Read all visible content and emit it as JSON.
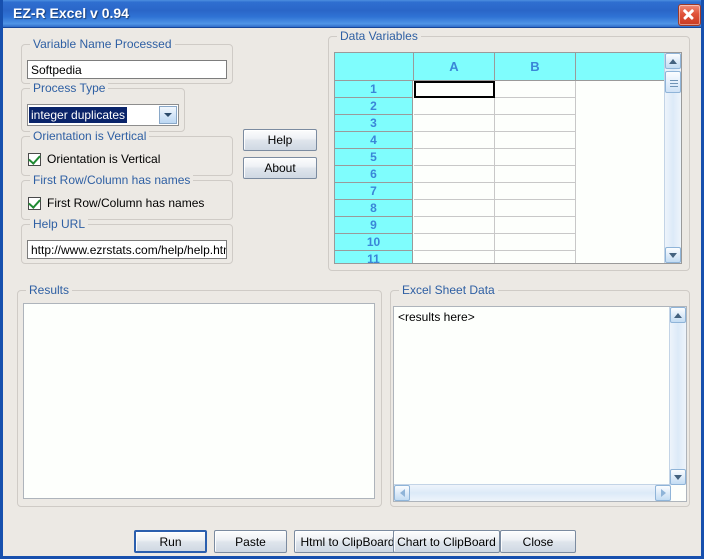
{
  "window": {
    "title": "EZ-R Excel v 0.94",
    "close_icon": "close-icon"
  },
  "left_panel": {
    "variable_name_group": {
      "legend": "Variable Name Processed",
      "value": "Softpedia"
    },
    "process_type_group": {
      "legend": "Process Type",
      "selected": "integer duplicates"
    },
    "orientation_group": {
      "legend": "Orientation is Vertical",
      "checkbox_label": "Orientation is Vertical",
      "checked": true
    },
    "first_row_group": {
      "legend": "First Row/Column has names",
      "checkbox_label": "First Row/Column has names",
      "checked": true
    },
    "help_url_group": {
      "legend": "Help URL",
      "value": "http://www.ezrstats.com/help/help.htm"
    },
    "help_button": "Help",
    "about_button": "About"
  },
  "data_variables": {
    "legend": "Data Variables",
    "columns": [
      "A",
      "B"
    ],
    "rows": [
      "1",
      "2",
      "3",
      "4",
      "5",
      "6",
      "7",
      "8",
      "9",
      "10",
      "11"
    ],
    "selected_cell": "A1",
    "cells": [
      [
        "",
        ""
      ],
      [
        "",
        ""
      ],
      [
        "",
        ""
      ],
      [
        "",
        ""
      ],
      [
        "",
        ""
      ],
      [
        "",
        ""
      ],
      [
        "",
        ""
      ],
      [
        "",
        ""
      ],
      [
        "",
        ""
      ],
      [
        "",
        ""
      ],
      [
        "",
        ""
      ]
    ]
  },
  "results_panel": {
    "legend": "Results",
    "content": ""
  },
  "excel_sheet_panel": {
    "legend": "Excel Sheet Data",
    "content": "<results here>"
  },
  "footer_buttons": [
    {
      "label": "Run",
      "focused": true
    },
    {
      "label": "Paste",
      "focused": false
    },
    {
      "label": "Html to ClipBoard",
      "focused": false
    },
    {
      "label": "Chart to ClipBoard",
      "focused": false
    },
    {
      "label": "Close",
      "focused": false
    }
  ],
  "colors": {
    "titlebar_blue": "#2f6fd0",
    "window_border": "#1750ae",
    "panel_bg": "#ece9e4",
    "legend_text": "#2e5fa3",
    "grid_header_cyan": "#7ffdfd",
    "grid_header_text": "#3a86d8",
    "close_red": "#e0533a",
    "check_green": "#1f8a32",
    "combo_highlight": "#0a246a"
  }
}
